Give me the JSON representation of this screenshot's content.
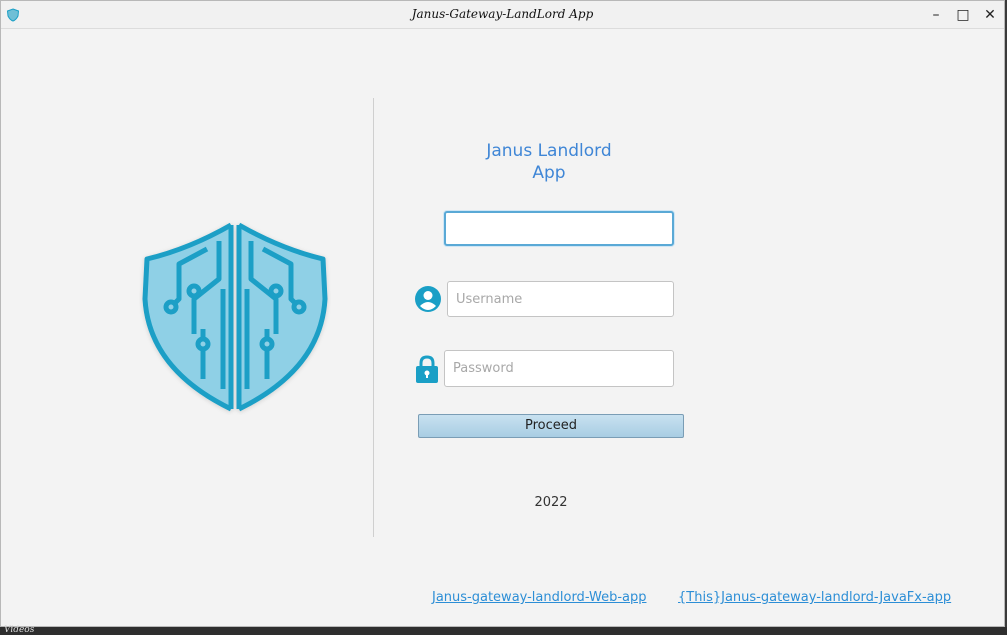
{
  "window": {
    "title": "Janus-Gateway-LandLord App",
    "app_icon": "shield-icon",
    "controls": {
      "minimize": "–",
      "maximize": "□",
      "close": "✕"
    }
  },
  "branding": {
    "logo": "circuit-shield-logo",
    "title": "Janus Landlord App"
  },
  "form": {
    "top_field_value": "",
    "username_placeholder": "Username",
    "password_placeholder": "Password",
    "proceed_label": "Proceed"
  },
  "footer": {
    "year": "2022",
    "links": [
      {
        "label": "Janus-gateway-landlord-Web-app"
      },
      {
        "label": "{This}Janus-gateway-landlord-JavaFx-app"
      }
    ]
  },
  "taskbar": {
    "label": "Videos"
  },
  "colors": {
    "accent": "#3f86d6",
    "icon_teal": "#1a9fc6",
    "link": "#2c8ed6"
  }
}
